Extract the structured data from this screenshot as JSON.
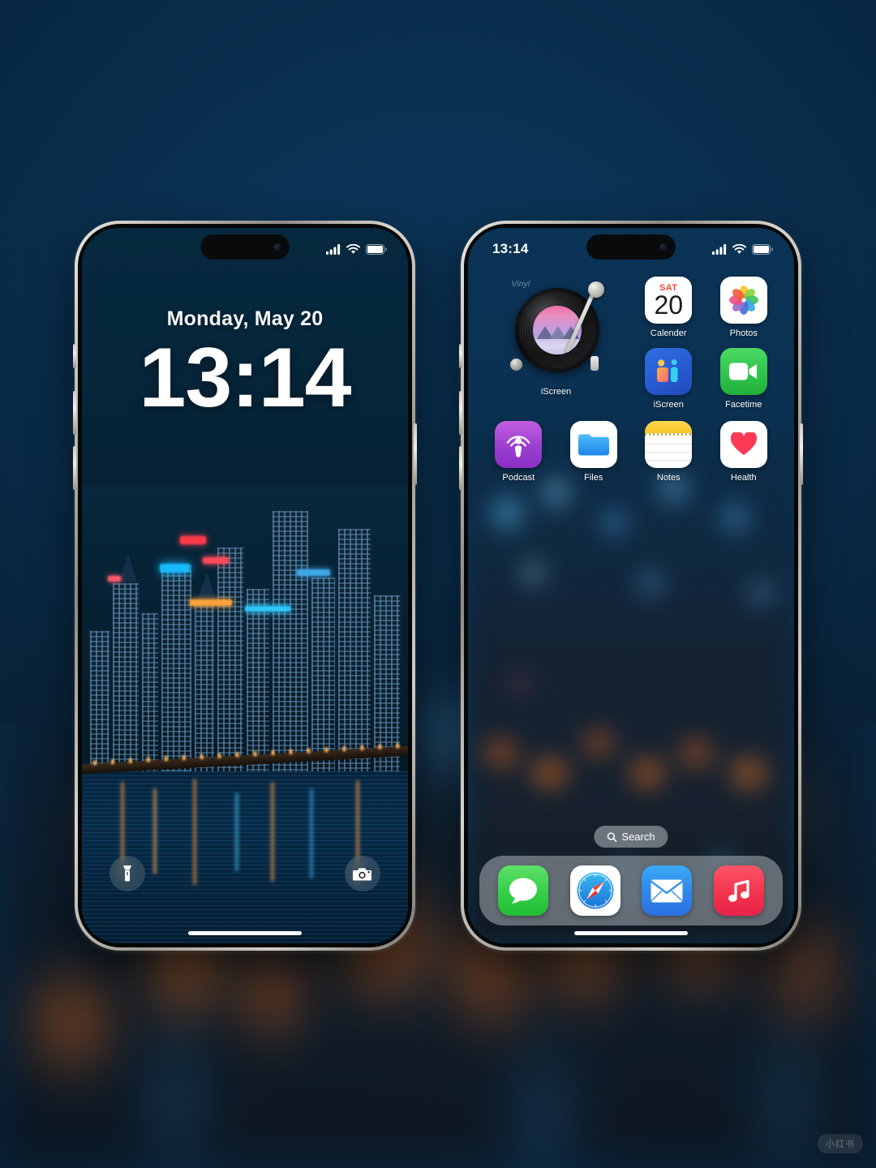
{
  "background": {
    "sky_color": "#0a3355",
    "bokeh_orange": "#d66a20",
    "bokeh_blue": "#2e86c4"
  },
  "lock_screen": {
    "name": "iPhone Lock Screen",
    "status_bar": {
      "time": "",
      "signal_icon": "cellular-signal-icon",
      "wifi_icon": "wifi-icon",
      "battery_icon": "battery-icon"
    },
    "date": "Monday, May 20",
    "time": "13:14",
    "actions": [
      {
        "name": "flashlight",
        "icon": "flashlight-icon"
      },
      {
        "name": "camera",
        "icon": "camera-icon"
      }
    ],
    "home_indicator": true
  },
  "home_screen": {
    "name": "iPhone Home Screen",
    "status_bar": {
      "time": "13:14",
      "signal_icon": "cellular-signal-icon",
      "wifi_icon": "wifi-icon",
      "battery_icon": "battery-icon"
    },
    "widget": {
      "title": "Vinyl",
      "label": "iScreen",
      "art_description": "mountain-landscape-record-label"
    },
    "apps_row1": [
      {
        "label": "Calender",
        "icon": "calendar-icon",
        "dow": "SAT",
        "day": "20"
      },
      {
        "label": "Photos",
        "icon": "photos-icon"
      }
    ],
    "apps_row2": [
      {
        "label": "iScreen",
        "icon": "iscreen-icon"
      },
      {
        "label": "Facetime",
        "icon": "facetime-icon"
      }
    ],
    "apps_row3": [
      {
        "label": "Podcast",
        "icon": "podcast-icon"
      },
      {
        "label": "Files",
        "icon": "files-icon"
      },
      {
        "label": "Notes",
        "icon": "notes-icon"
      },
      {
        "label": "Health",
        "icon": "health-icon"
      }
    ],
    "search": {
      "label": "Search",
      "icon": "search-icon"
    },
    "dock": [
      {
        "label": "Messages",
        "icon": "messages-icon"
      },
      {
        "label": "Safari",
        "icon": "safari-icon"
      },
      {
        "label": "Mail",
        "icon": "mail-icon"
      },
      {
        "label": "Music",
        "icon": "music-icon"
      }
    ],
    "home_indicator": true
  },
  "watermark": {
    "text": "小红书"
  }
}
